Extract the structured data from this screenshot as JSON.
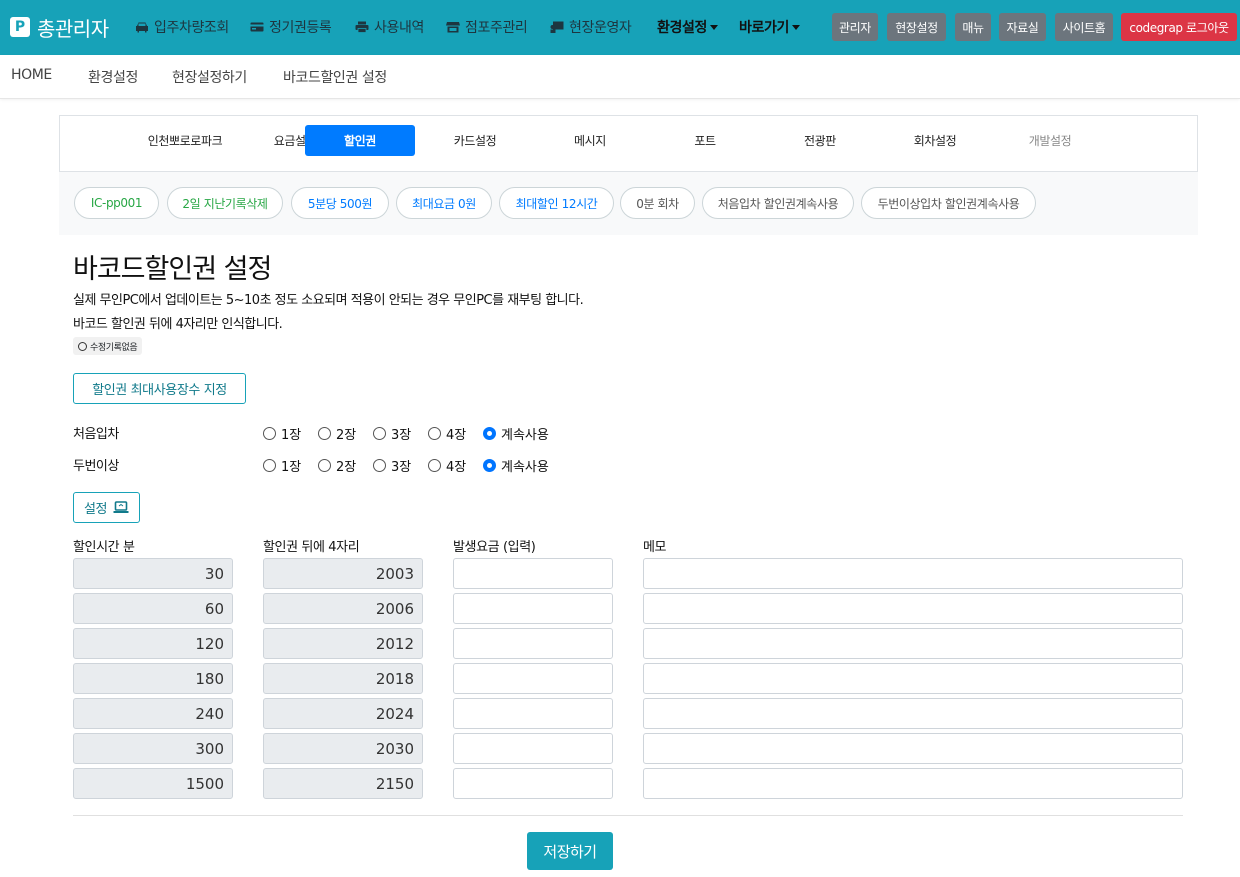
{
  "navbar": {
    "brand_logo": "P",
    "brand": "총관리자",
    "links": [
      {
        "label": "입주차량조회",
        "icon": "car-icon"
      },
      {
        "label": "정기권등록",
        "icon": "card-icon"
      },
      {
        "label": "사용내역",
        "icon": "print-icon"
      },
      {
        "label": "점포주관리",
        "icon": "store-icon"
      },
      {
        "label": "현장운영자",
        "icon": "user-chalkboard-icon"
      }
    ],
    "dropdowns": [
      "환경설정",
      "바로가기"
    ],
    "buttons": [
      "관리자",
      "현장설정",
      "매뉴",
      "자료실",
      "사이트홈"
    ],
    "logout": "codegrap 로그아웃",
    "accent": "#17a2b8"
  },
  "breadcrumb": [
    "HOME",
    "환경설정",
    "현장설정하기",
    "바코드할인권 설정"
  ],
  "tabs": [
    "인천뽀로로파크",
    "요금설정",
    "할인권",
    "카드설정",
    "메시지",
    "포트",
    "전광판",
    "회차설정",
    "개발설정"
  ],
  "active_tab": "할인권",
  "pills": [
    "IC-pp001",
    "2일 지난기록삭제",
    "5분당 500원",
    "최대요금 0원",
    "최대할인 12시간",
    "0분 회차",
    "처음입차 할인권계속사용",
    "두번이상입차 할인권계속사용"
  ],
  "page": {
    "title": "바코드할인권 설정",
    "desc1": "실제 무인PC에서 업데이트는 5~10초 정도 소요되며 적용이 안되는 경우 무인PC를 재부팅 합니다.",
    "desc2": "바코드 할인권 뒤에 4자리만 인식합니다.",
    "history": "수정기록없음",
    "max_button": "할인권 최대사용장수 지정"
  },
  "radio_groups": [
    {
      "label": "처음입차",
      "options": [
        "1장",
        "2장",
        "3장",
        "4장",
        "계속사용"
      ],
      "selected": "계속사용"
    },
    {
      "label": "두번이상",
      "options": [
        "1장",
        "2장",
        "3장",
        "4장",
        "계속사용"
      ],
      "selected": "계속사용"
    }
  ],
  "set_button": "설정",
  "table": {
    "headers": [
      "할인시간 분",
      "할인권 뒤에 4자리",
      "발생요금 (입력)",
      "메모"
    ],
    "rows": [
      {
        "minutes": "30",
        "code": "2003",
        "fee": "",
        "memo": ""
      },
      {
        "minutes": "60",
        "code": "2006",
        "fee": "",
        "memo": ""
      },
      {
        "minutes": "120",
        "code": "2012",
        "fee": "",
        "memo": ""
      },
      {
        "minutes": "180",
        "code": "2018",
        "fee": "",
        "memo": ""
      },
      {
        "minutes": "240",
        "code": "2024",
        "fee": "",
        "memo": ""
      },
      {
        "minutes": "300",
        "code": "2030",
        "fee": "",
        "memo": ""
      },
      {
        "minutes": "1500",
        "code": "2150",
        "fee": "",
        "memo": ""
      }
    ]
  },
  "save_button": "저장하기"
}
